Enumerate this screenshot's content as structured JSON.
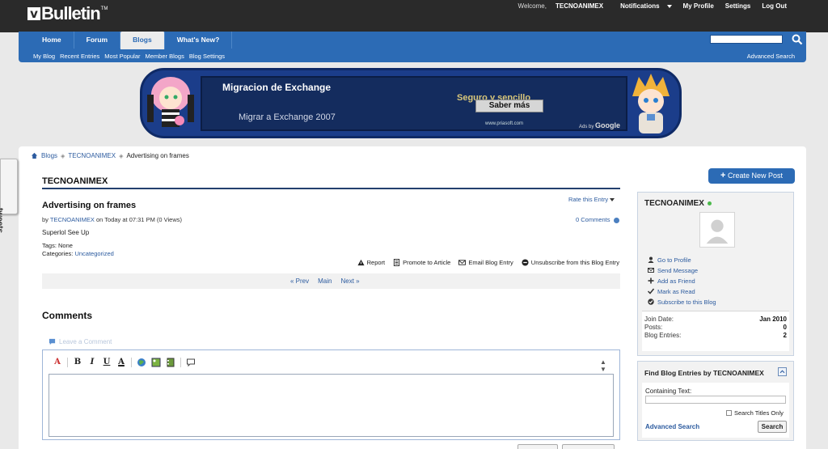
{
  "brand": {
    "logo_v": "v",
    "logo_text": "Bulletin",
    "logo_tm": "TM"
  },
  "topnav": {
    "welcome": "Welcome,",
    "username": "TECNOANIMEX",
    "notifications": "Notifications",
    "my_profile": "My Profile",
    "settings": "Settings",
    "logout": "Log Out"
  },
  "navbar": {
    "tabs": [
      {
        "label": "Home"
      },
      {
        "label": "Forum"
      },
      {
        "label": "Blogs"
      },
      {
        "label": "What's New?"
      }
    ],
    "subnav": [
      "My Blog",
      "Recent Entries",
      "Most Popular",
      "Member Blogs",
      "Blog Settings"
    ],
    "advanced_search": "Advanced Search"
  },
  "ad": {
    "title": "Migracion de Exchange",
    "subtitle": "Migrar a Exchange 2007",
    "slogan": "Seguro y sencillo",
    "button": "Saber más",
    "url": "www.priasoft.com",
    "ads_by": "Ads by",
    "google": "Google"
  },
  "tweets_tab": "tweets",
  "breadcrumb": {
    "blogs": "Blogs",
    "user": "TECNOANIMEX",
    "current": "Advertising on frames"
  },
  "blog": {
    "title": "TECNOANIMEX",
    "new_post": "Create New Post",
    "new_post_plus": "+"
  },
  "entry": {
    "title": "Advertising on frames",
    "rate": "Rate this Entry",
    "by": "by",
    "author": "TECNOANIMEX",
    "date": "on Today at 07:31 PM (0 Views)",
    "comments_link": "0 Comments",
    "text": "Superlol See Up",
    "tags": "Tags: None",
    "categories_label": "Categories:",
    "category": "Uncategorized"
  },
  "actions": [
    "Report",
    "Promote to Article",
    "Email Blog Entry",
    "Unsubscribe from this Blog Entry"
  ],
  "pager": {
    "prev": "« Prev",
    "main": "Main",
    "next": "Next »"
  },
  "comments": {
    "heading": "Comments",
    "leave": "Leave a Comment",
    "toolbar": [
      "A",
      "B",
      "I",
      "U",
      "A"
    ]
  },
  "sidebar": {
    "profile": {
      "name": "TECNOANIMEX",
      "links": [
        "Go to Profile",
        "Send Message",
        "Add as Friend",
        "Mark as Read",
        "Subscribe to this Blog"
      ],
      "stats": [
        {
          "label": "Join Date:",
          "value": "Jan 2010"
        },
        {
          "label": "Posts:",
          "value": "0"
        },
        {
          "label": "Blog Entries:",
          "value": "2"
        }
      ]
    },
    "find": {
      "heading": "Find Blog Entries by TECNOANIMEX",
      "containing_label": "Containing Text:",
      "titles_only": "Search Titles Only",
      "advanced": "Advanced Search",
      "search_button": "Search"
    }
  },
  "colors": {
    "brand_blue": "#2c6bb5",
    "topbar": "#2a2a2a",
    "link": "#2c5b9f"
  }
}
